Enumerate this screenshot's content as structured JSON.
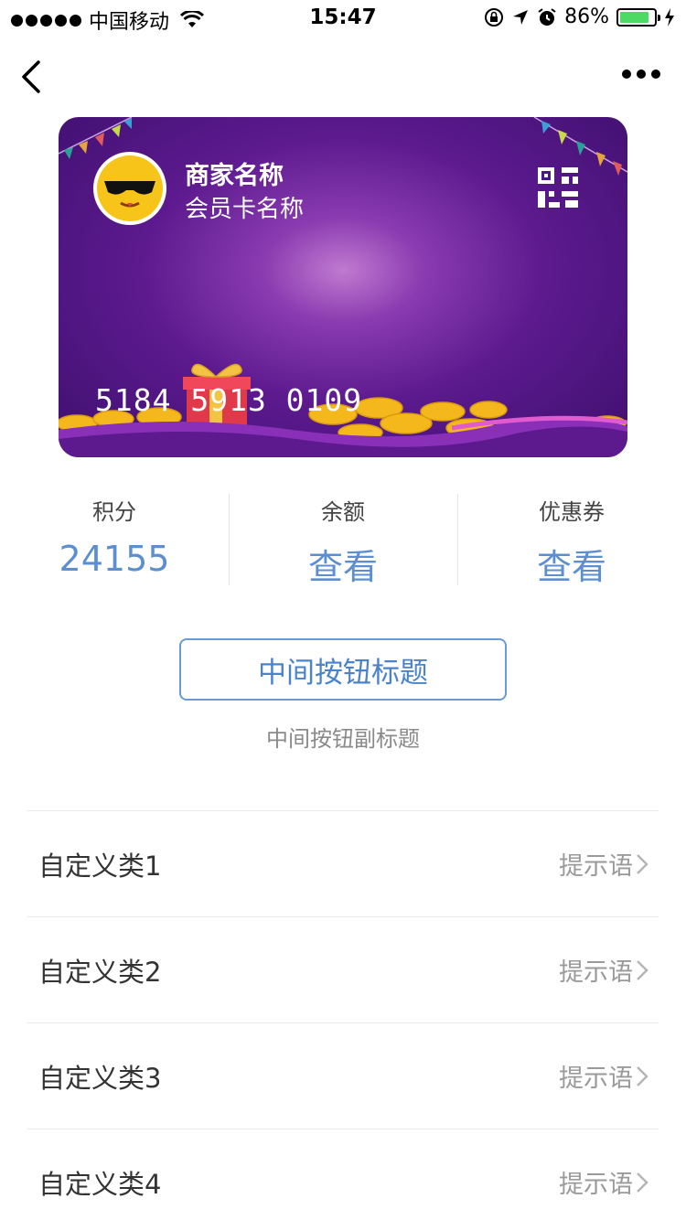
{
  "status_bar": {
    "carrier": "中国移动",
    "time": "15:47",
    "battery": "86%",
    "battery_level": 0.86,
    "icons": [
      "signal-dots-icon",
      "wifi-icon",
      "rotation-lock-icon",
      "location-arrow-icon",
      "alarm-icon",
      "battery-icon",
      "charging-icon"
    ]
  },
  "nav": {
    "back_icon": "chevron-left-icon",
    "more_icon": "more-dots-icon"
  },
  "card": {
    "merchant_name": "商家名称",
    "card_name": "会员卡名称",
    "card_number": "5184 5913 0109",
    "qr_icon": "qr-code-icon",
    "logo_icon": "sunglasses-emoji-logo"
  },
  "stats": [
    {
      "label": "积分",
      "value": "24155"
    },
    {
      "label": "余额",
      "value": "查看"
    },
    {
      "label": "优惠券",
      "value": "查看"
    }
  ],
  "middle_button": {
    "title": "中间按钮标题",
    "subtitle": "中间按钮副标题"
  },
  "list": [
    {
      "title": "自定义类1",
      "hint": "提示语"
    },
    {
      "title": "自定义类2",
      "hint": "提示语"
    },
    {
      "title": "自定义类3",
      "hint": "提示语"
    },
    {
      "title": "自定义类4",
      "hint": "提示语"
    }
  ],
  "colors": {
    "accent": "#5b8fd1",
    "button_border": "#6a9ad8",
    "card_purple": "#5c1a8e",
    "battery_green": "#4cd964"
  }
}
